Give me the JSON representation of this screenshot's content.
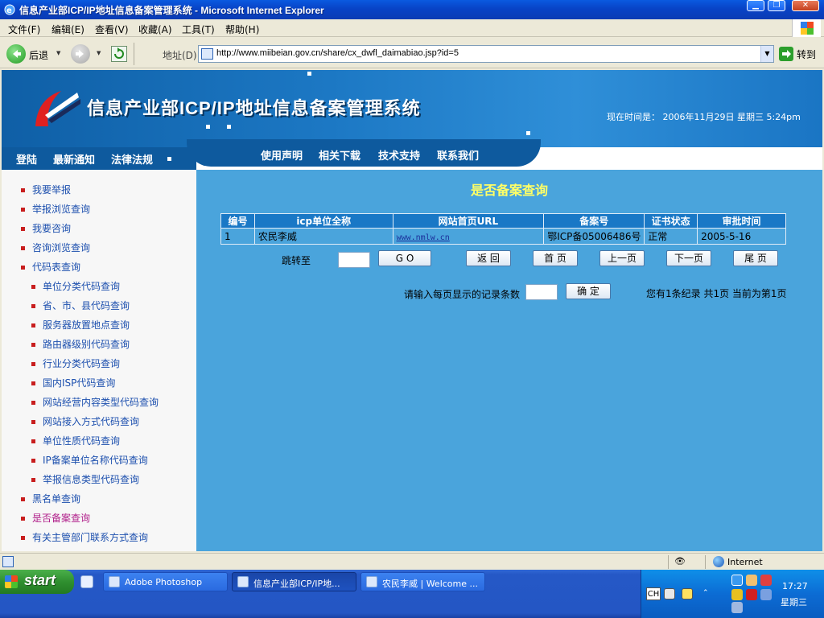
{
  "window": {
    "title": "信息产业部ICP/IP地址信息备案管理系统 - Microsoft Internet Explorer",
    "min_label": "▁",
    "max_label": "❐",
    "close_label": "✕"
  },
  "menu": [
    "文件(F)",
    "编辑(E)",
    "查看(V)",
    "收藏(A)",
    "工具(T)",
    "帮助(H)"
  ],
  "toolbar": {
    "back_label": "后退",
    "address_label": "地址(D)",
    "url": "http://www.miibeian.gov.cn/share/cx_dwfl_daimabiao.jsp?id=5",
    "go_label": "转到"
  },
  "banner": {
    "site_title": "信息产业部ICP/IP地址信息备案管理系统",
    "datetime": "现在时间是： 2006年11月29日 星期三 5:24pm",
    "left_nav": [
      "登陆",
      "最新通知",
      "法律法规"
    ],
    "right_nav": [
      "使用声明",
      "相关下载",
      "技术支持",
      "联系我们"
    ]
  },
  "sidebar": {
    "items": [
      {
        "label": "我要举报",
        "sub": false
      },
      {
        "label": "举报浏览查询",
        "sub": false
      },
      {
        "label": "我要咨询",
        "sub": false
      },
      {
        "label": "咨询浏览查询",
        "sub": false
      },
      {
        "label": "代码表查询",
        "sub": false
      },
      {
        "label": "单位分类代码查询",
        "sub": true
      },
      {
        "label": "省、市、县代码查询",
        "sub": true
      },
      {
        "label": "服务器放置地点查询",
        "sub": true
      },
      {
        "label": "路由器级别代码查询",
        "sub": true
      },
      {
        "label": "行业分类代码查询",
        "sub": true
      },
      {
        "label": "国内ISP代码查询",
        "sub": true
      },
      {
        "label": "网站经营内容类型代码查询",
        "sub": true
      },
      {
        "label": "网站接入方式代码查询",
        "sub": true
      },
      {
        "label": "单位性质代码查询",
        "sub": true
      },
      {
        "label": "IP备案单位名称代码查询",
        "sub": true
      },
      {
        "label": "举报信息类型代码查询",
        "sub": true
      },
      {
        "label": "黑名单查询",
        "sub": false
      },
      {
        "label": "是否备案查询",
        "sub": false
      },
      {
        "label": "有关主管部门联系方式查询",
        "sub": false
      }
    ]
  },
  "main": {
    "title": "是否备案查询",
    "table": {
      "headers": [
        "编号",
        "icp单位全称",
        "网站首页URL",
        "备案号",
        "证书状态",
        "审批时间"
      ],
      "rows": [
        [
          "1",
          "农民李威",
          "www.nmlw.cn",
          "鄂ICP备05006486号",
          "正常",
          "2005-5-16"
        ]
      ]
    },
    "jump_label": "跳转至",
    "buttons": {
      "go": "G O",
      "back": "返 回",
      "first": "首 页",
      "prev": "上一页",
      "next": "下一页",
      "last": "尾 页",
      "confirm": "确 定"
    },
    "per_page_label": "请输入每页显示的记录条数",
    "summary": "您有1条纪录  共1页  当前为第1页"
  },
  "statusbar": {
    "zone": "Internet"
  },
  "taskbar": {
    "start": "start",
    "tasks": [
      {
        "label": "Adobe Photoshop",
        "active": false
      },
      {
        "label": "信息产业部ICP/IP地...",
        "active": true
      },
      {
        "label": "农民李威 | Welcome ...",
        "active": false
      }
    ],
    "input_lang": "CH",
    "clock": "17:27",
    "day": "星期三"
  }
}
